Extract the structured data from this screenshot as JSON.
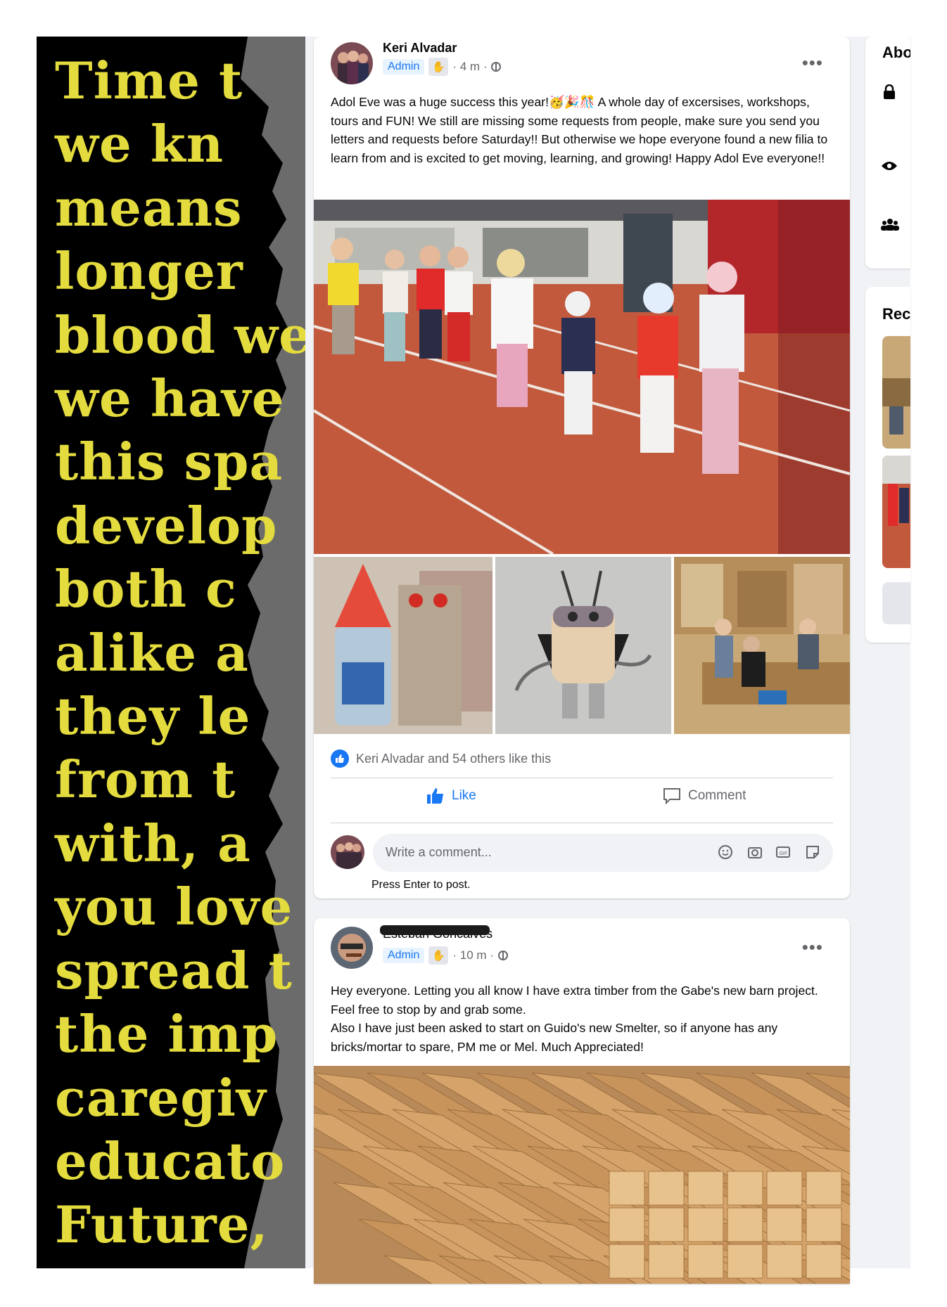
{
  "poster": {
    "lines": [
      "Time t",
      "we kn",
      "means",
      "longer",
      "blood we",
      "we have",
      "this spa",
      "develop",
      "both c",
      "alike a",
      "they le",
      "from t",
      "with, a",
      "you love",
      "spread t",
      "the imp",
      "caregiv",
      "educato",
      "Future,"
    ]
  },
  "post1": {
    "author": "Keri Alvadar",
    "badge": "Admin",
    "time": "4 m",
    "text": "Adol Eve was a huge success this year!🥳🎉🎊 A whole day of excersises, workshops, tours and FUN! We still are missing some requests from people, make sure you send you letters and requests before Saturday!! But otherwise we hope everyone found a new filia to learn from and is excited to get moving, learning, and growing! Happy Adol Eve everyone!!",
    "likes": "Keri Alvadar and 54 others like this",
    "like_label": "Like",
    "comment_label": "Comment",
    "comment_placeholder": "Write a comment...",
    "press_enter": "Press Enter to post."
  },
  "post2": {
    "author": "Esteban Goncalves",
    "badge": "Admin",
    "time": "10 m",
    "text": "Hey everyone. Letting you all know I have extra timber from the Gabe's new barn project. Feel free to stop by and grab some.\nAlso I have just been asked to start on Guido's new Smelter, so if anyone has any bricks/mortar to spare, PM me or Mel. Much Appreciated!"
  },
  "sidebar": {
    "about_label": "Abo",
    "recent_label": "Rec"
  },
  "colors": {
    "poster_text": "#e4dc3e",
    "facebook_blue": "#1877f2"
  },
  "icons": [
    "more-icon",
    "globe-icon",
    "like-icon",
    "comment-icon",
    "emoji-icon",
    "camera-icon",
    "gif-icon",
    "sticker-icon",
    "lock-icon",
    "eye-icon",
    "people-icon"
  ]
}
